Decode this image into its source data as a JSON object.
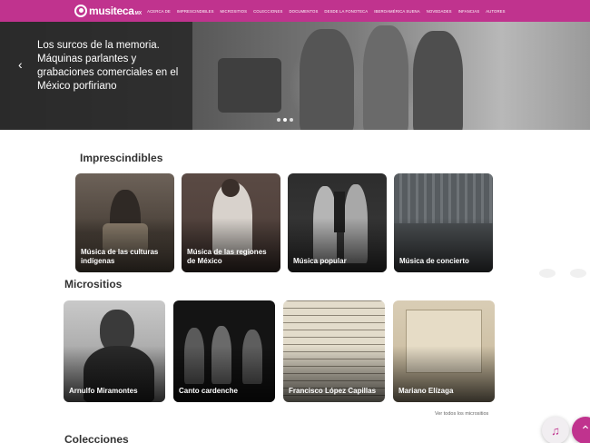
{
  "brand": {
    "name": "musiteca",
    "suffix": "MX"
  },
  "nav": [
    "Acerca de",
    "Imprescindibles",
    "Micrositios",
    "Colecciones",
    "Documentos",
    "Desde la fonoteca",
    "Iberoamérica suena",
    "Novedades",
    "Infancias",
    "Autores"
  ],
  "hero": {
    "title": "Los surcos de la memoria. Máquinas parlantes y grabaciones comerciales en el México porfiriano",
    "prev_icon": "chevron-left-icon",
    "slide_count": 3,
    "active_slide": 2
  },
  "imprescindibles": {
    "title": "Imprescindibles",
    "cards": [
      {
        "label": "Música de las culturas indígenas"
      },
      {
        "label": "Música de las regiones de México"
      },
      {
        "label": "Música popular"
      },
      {
        "label": "Música de concierto"
      }
    ]
  },
  "micrositios": {
    "title": "Micrositios",
    "cards": [
      {
        "label": "Arnulfo Miramontes"
      },
      {
        "label": "Canto cardenche"
      },
      {
        "label": "Francisco López Capillas"
      },
      {
        "label": "Mariano Elízaga"
      }
    ],
    "more_link": "Ver todos los micrositios"
  },
  "colecciones": {
    "title": "Colecciones"
  },
  "floating": {
    "music_icon": "music-note-icon",
    "up_icon": "chevron-up-icon",
    "music_glyph": "♫",
    "up_glyph": "⌃"
  },
  "colors": {
    "brand": "#c0338e",
    "hero_overlay": "#282828"
  }
}
